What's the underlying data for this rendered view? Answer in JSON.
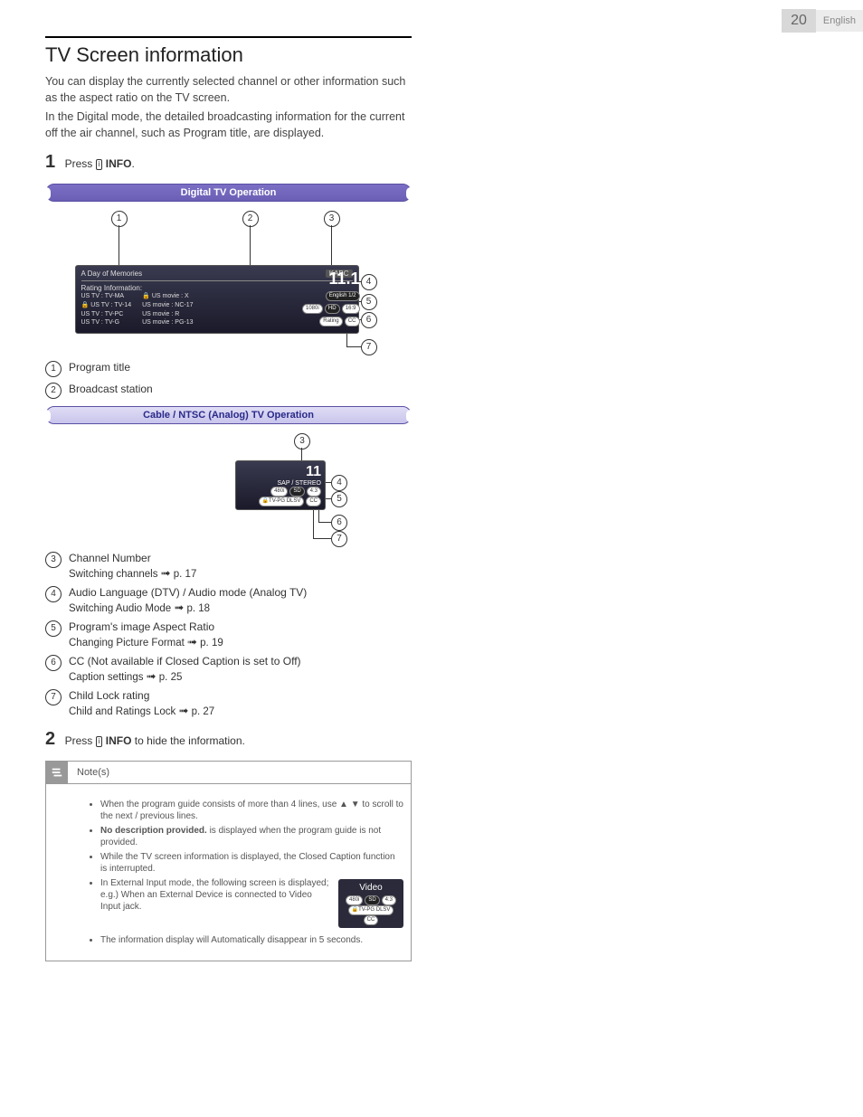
{
  "page_number": "20",
  "language": "English",
  "title": "TV Screen information",
  "intro1": "You can display the currently selected channel or other information such as the aspect ratio on the TV screen.",
  "intro2": "In the Digital mode, the detailed broadcasting information for the current off the air channel, such as Program title, are displayed.",
  "step1_num": "1",
  "step1_press": "Press ",
  "step1_info": "INFO",
  "step1_period": ".",
  "ribbon1": "Digital TV Operation",
  "osd": {
    "program_title": "A Day of Memories",
    "station": "KABC",
    "rating_header": "Rating Information:",
    "col1": [
      "US TV : TV-MA",
      "US TV : TV-14",
      "US TV : TV-PC",
      "US TV : TV-G"
    ],
    "col2": [
      "US movie : X",
      "US movie : NC-17",
      "US movie : R",
      "US movie : PG-13"
    ],
    "channel": "11.1",
    "lang": "English 1/2",
    "res": "1080i",
    "def": "HD",
    "ar": "16:9",
    "rating": "Rating",
    "cc": "CC",
    "locked_row": 1
  },
  "simple_list": {
    "i1": "Program title",
    "i2": "Broadcast station"
  },
  "ribbon2": "Cable / NTSC (Analog) TV Operation",
  "osd2": {
    "channel": "11",
    "audio": "SAP / STEREO",
    "res": "480i",
    "def": "SD",
    "ar": "4:3",
    "rating": "TV-PG DLSV",
    "cc": "CC"
  },
  "detail_list": {
    "i3_title": "Channel Number",
    "i3_sub": "Switching channels",
    "i3_page": "p. 17",
    "i4_title": "Audio Language (DTV) / Audio mode (Analog TV)",
    "i4_sub": "Switching Audio Mode",
    "i4_page": "p. 18",
    "i5_title": "Program's image Aspect Ratio",
    "i5_sub": "Changing Picture Format",
    "i5_page": "p. 19",
    "i6_title": "CC (Not available if Closed Caption is set to Off)",
    "i6_sub": "Caption settings",
    "i6_page": "p. 25",
    "i7_title": "Child Lock rating",
    "i7_sub": "Child and Ratings Lock",
    "i7_page": "p. 27"
  },
  "step2_num": "2",
  "step2_press": "Press ",
  "step2_info": "INFO",
  "step2_rest": " to hide the information.",
  "notes_header": "Note(s)",
  "notes": {
    "n1a": "When the program guide consists of more than 4 lines, use ",
    "n1b": " to scroll to the next / previous lines.",
    "n2a": "No description provided.",
    "n2b": " is displayed when the program guide is not provided.",
    "n3": "While the TV screen information is displayed, the Closed Caption function is interrupted.",
    "n4": "In External Input mode, the following screen is displayed; e.g.) When an External Device is connected to Video Input jack.",
    "n5": "The information display will Automatically disappear in 5 seconds.",
    "float_video": "Video",
    "float_res": "480i",
    "float_def": "SD",
    "float_ar": "4:3",
    "float_rating": "TV-PG DLSV",
    "float_cc": "CC"
  }
}
